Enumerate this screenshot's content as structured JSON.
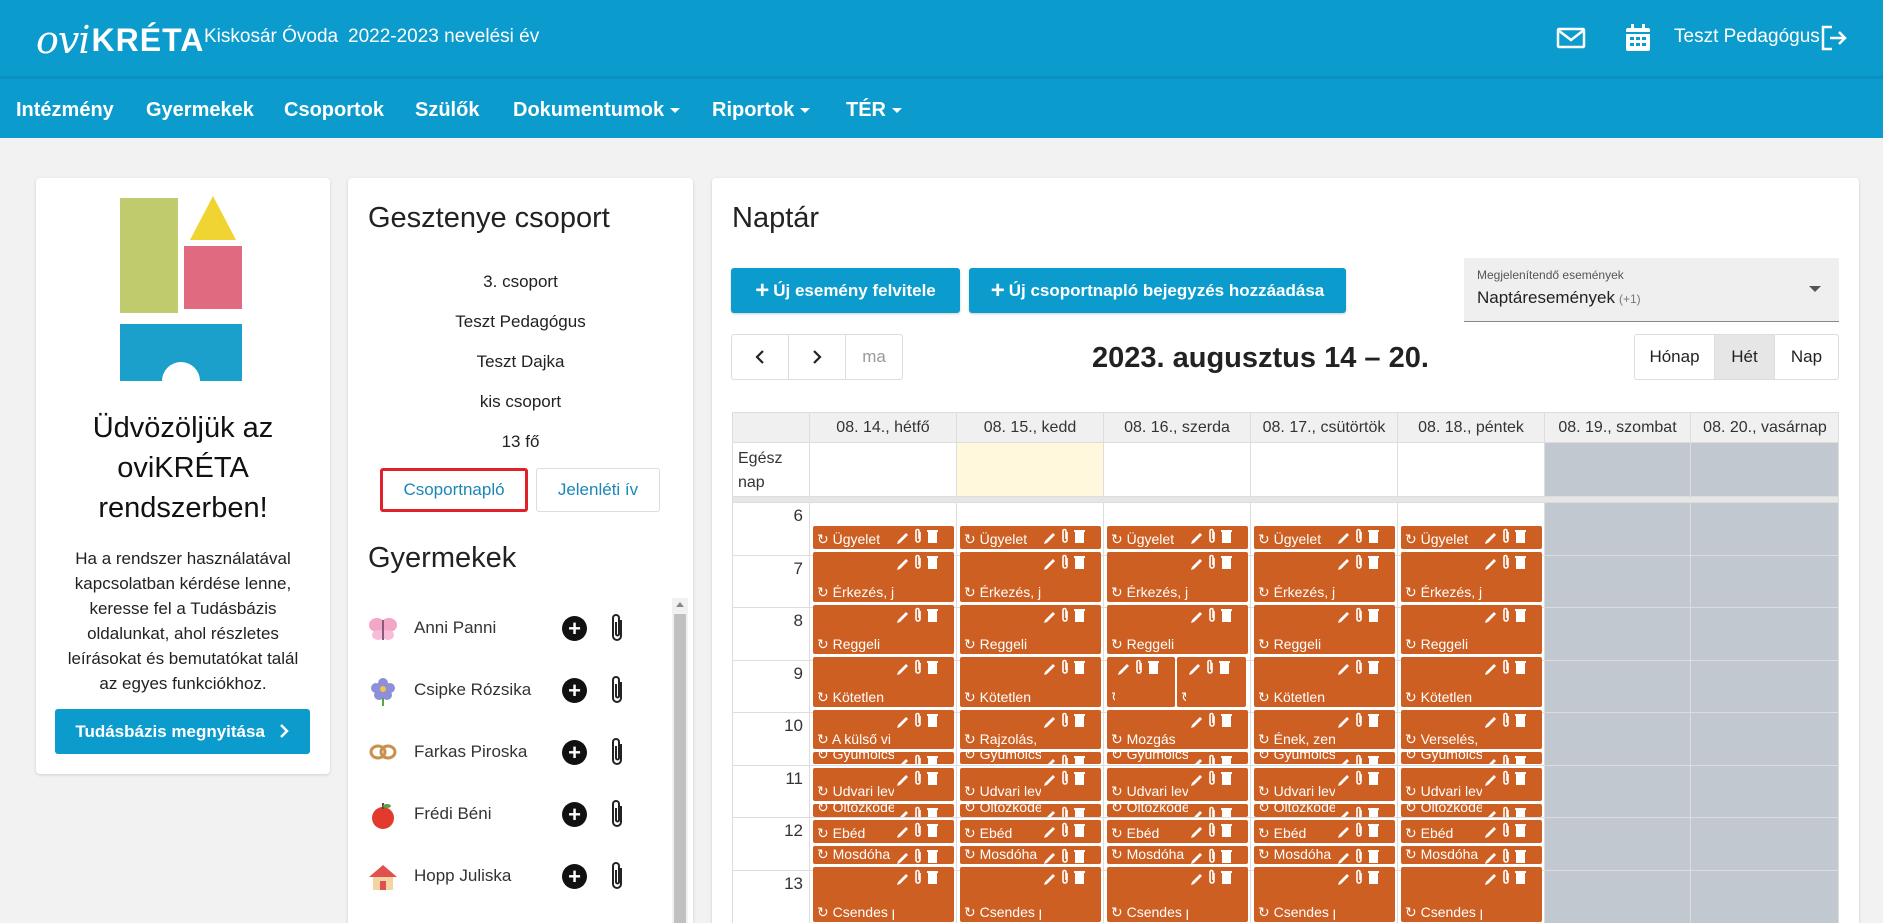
{
  "header": {
    "logo_ovi": "ovi",
    "logo_kreta": "KRÉTA",
    "institution": "Kiskosár Óvoda",
    "school_year": "2022-2023 nevelési év",
    "user_name": "Teszt Pedagógus"
  },
  "nav": {
    "items": [
      "Intézmény",
      "Gyermekek",
      "Csoportok",
      "Szülők",
      "Dokumentumok",
      "Riportok",
      "TÉR"
    ]
  },
  "welcome": {
    "title_1": "Üdvözöljük az",
    "title_2": "oviKRÉTA",
    "title_3": "rendszerben!",
    "text_1": "Ha a rendszer használatával",
    "text_2": "kapcsolatban kérdése lenne,",
    "text_3": "keresse fel a Tudásbázis",
    "text_4": "oldalunkat, ahol részletes",
    "text_5": "leírásokat és bemutatókat talál",
    "text_6": "az egyes funkciókhoz.",
    "button": "Tudásbázis megnyitása"
  },
  "group": {
    "title": "Gesztenye csoport",
    "number": "3. csoport",
    "teacher": "Teszt Pedagógus",
    "nanny": "Teszt Dajka",
    "type": "kis csoport",
    "count": "13 fő",
    "btn_diary": "Csoportnapló",
    "btn_attendance": "Jelenléti ív",
    "kids_title": "Gyermekek",
    "kids": [
      {
        "name": "Anni Panni",
        "icon": "butterfly-icon"
      },
      {
        "name": "Csipke Rózsika",
        "icon": "flower-icon"
      },
      {
        "name": "Farkas Piroska",
        "icon": "pretzel-icon"
      },
      {
        "name": "Frédi Béni",
        "icon": "apple-icon"
      },
      {
        "name": "Hopp Juliska",
        "icon": "house-icon"
      }
    ]
  },
  "calendar": {
    "title": "Naptár",
    "btn_new_event": "Új esemény felvitele",
    "btn_new_diary": "Új csoportnapló bejegyzés hozzáadása",
    "select_label": "Megjelenítendő események",
    "select_value": "Naptáresemények",
    "select_more": "(+1)",
    "today": "ma",
    "range": "2023. augusztus 14 – 20.",
    "views": [
      "Hónap",
      "Hét",
      "Nap"
    ],
    "allday_label_1": "Egész",
    "allday_label_2": "nap",
    "days": [
      "08. 14., hétfő",
      "08. 15., kedd",
      "08. 16., szerda",
      "08. 17., csütörtök",
      "08. 18., péntek",
      "08. 19., szombat",
      "08. 20., vasárnap"
    ],
    "hours": [
      "6",
      "7",
      "8",
      "9",
      "10",
      "11",
      "12",
      "13"
    ],
    "event_titles": {
      "ugyelet": "Ügyelet",
      "erkezes": "Érkezés, játék",
      "reggeli": "Reggeli",
      "kotetlen": "Kötetlen",
      "gyumolcs": "Gyümölcs",
      "udvari": "Udvari lev",
      "oltozkodes": "Öltözködés",
      "ebed": "Ebéd",
      "mosdo": "Mosdóha",
      "csendes": "Csendes pihenő",
      "blank": ""
    },
    "activity_by_day": [
      "A külső vi",
      "Rajzolás,",
      "Mozgás",
      "Ének, zen",
      "Verselés,"
    ],
    "colors": {
      "primary": "#0b9bcc",
      "event": "#cd5f22",
      "weekend": "#c2c8cf",
      "today": "#fff8dc",
      "highlight": "#e0202a"
    }
  }
}
